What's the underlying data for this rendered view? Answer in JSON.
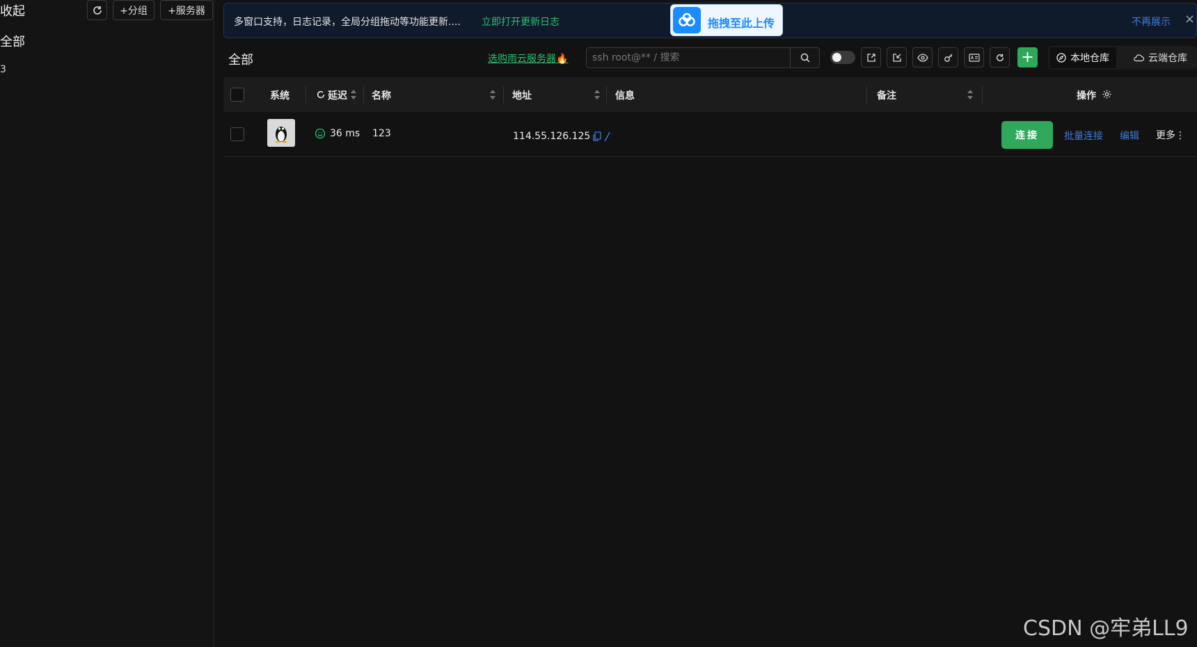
{
  "sidebar": {
    "collapse_label": "收起",
    "add_group_label": "+分组",
    "add_server_label": "+服务器",
    "group_all_label": "全部",
    "group_count": "3"
  },
  "banner": {
    "message": "多窗口支持，日志记录，全局分组拖动等功能更新....",
    "link_text": "立即打开更新日志",
    "dismiss_text": "不再展示",
    "close_label": "×"
  },
  "upload_badge": {
    "text": "拖拽至此上传"
  },
  "toolbar": {
    "section_title": "全部",
    "buy_link_text": "选购雨云服务器🔥",
    "search_placeholder": "ssh root@** / 搜索",
    "local_repo_label": "本地仓库",
    "cloud_repo_label": "云端仓库",
    "add_label": "+"
  },
  "table": {
    "headers": {
      "system": "系统",
      "latency": "延迟",
      "name": "名称",
      "address": "地址",
      "info": "信息",
      "remark": "备注",
      "actions": "操作"
    },
    "rows": [
      {
        "os": "linux",
        "latency": "36 ms",
        "name": "123",
        "address": "114.55.126.125",
        "info": "",
        "remark": "",
        "connect_label": "连接",
        "batch_connect_label": "批量连接",
        "edit_label": "编辑",
        "more_label": "更多⋮"
      }
    ]
  },
  "watermark": "CSDN @牢弟LL9",
  "colors": {
    "background": "#121212",
    "accent_green": "#2fa85b",
    "link_blue": "#3e7bd8",
    "link_green": "#2fbf71",
    "upload_blue": "#1a8cff"
  }
}
